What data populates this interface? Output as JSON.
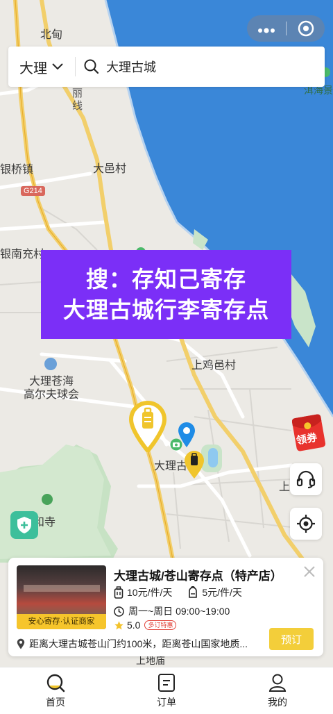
{
  "capsule": {
    "more_icon": "more-dots-icon",
    "close_icon": "mini-program-close-icon"
  },
  "search": {
    "city": "大理",
    "query": "大理古城"
  },
  "map": {
    "labels": {
      "beidian": "北甸",
      "lixian": "丽\n线",
      "yinqiaozhen": "银桥镇",
      "dayicun": "大邑村",
      "g214": "G214",
      "yinnanchongcun": "银南充村",
      "shangjiyicun": "上鸡邑村",
      "golf": "大理苍海\n高尔夫球会",
      "dali_ancient": "大理古",
      "hehesi": "和寺",
      "erhai": "洱海景",
      "right_fragment": "上",
      "bottom_fragment": "上地庙"
    }
  },
  "banner": {
    "line1": "搜：存知己寄存",
    "line2": "大理古城行李寄存点"
  },
  "red_packet": {
    "label": "领券"
  },
  "store_card": {
    "image_badge": "安心寄存·认证商家",
    "name": "大理古城/苍山寄存点（特产店）",
    "price_luggage": "10元/件/天",
    "price_bag": "5元/件/天",
    "hours": "周一~周日 09:00~19:00",
    "rating": "5.0",
    "tag": "多订特惠",
    "distance": "距离大理古城苍山门约100米，距离苍山国家地质...",
    "book_button": "预订"
  },
  "tabs": [
    {
      "label": "首页",
      "icon": "home-search-icon"
    },
    {
      "label": "订单",
      "icon": "order-icon"
    },
    {
      "label": "我的",
      "icon": "profile-icon"
    }
  ],
  "colors": {
    "accent": "#f3ce3a",
    "banner": "#7b2ff7",
    "water": "#3a87d8",
    "badge": "#f6c52b"
  }
}
